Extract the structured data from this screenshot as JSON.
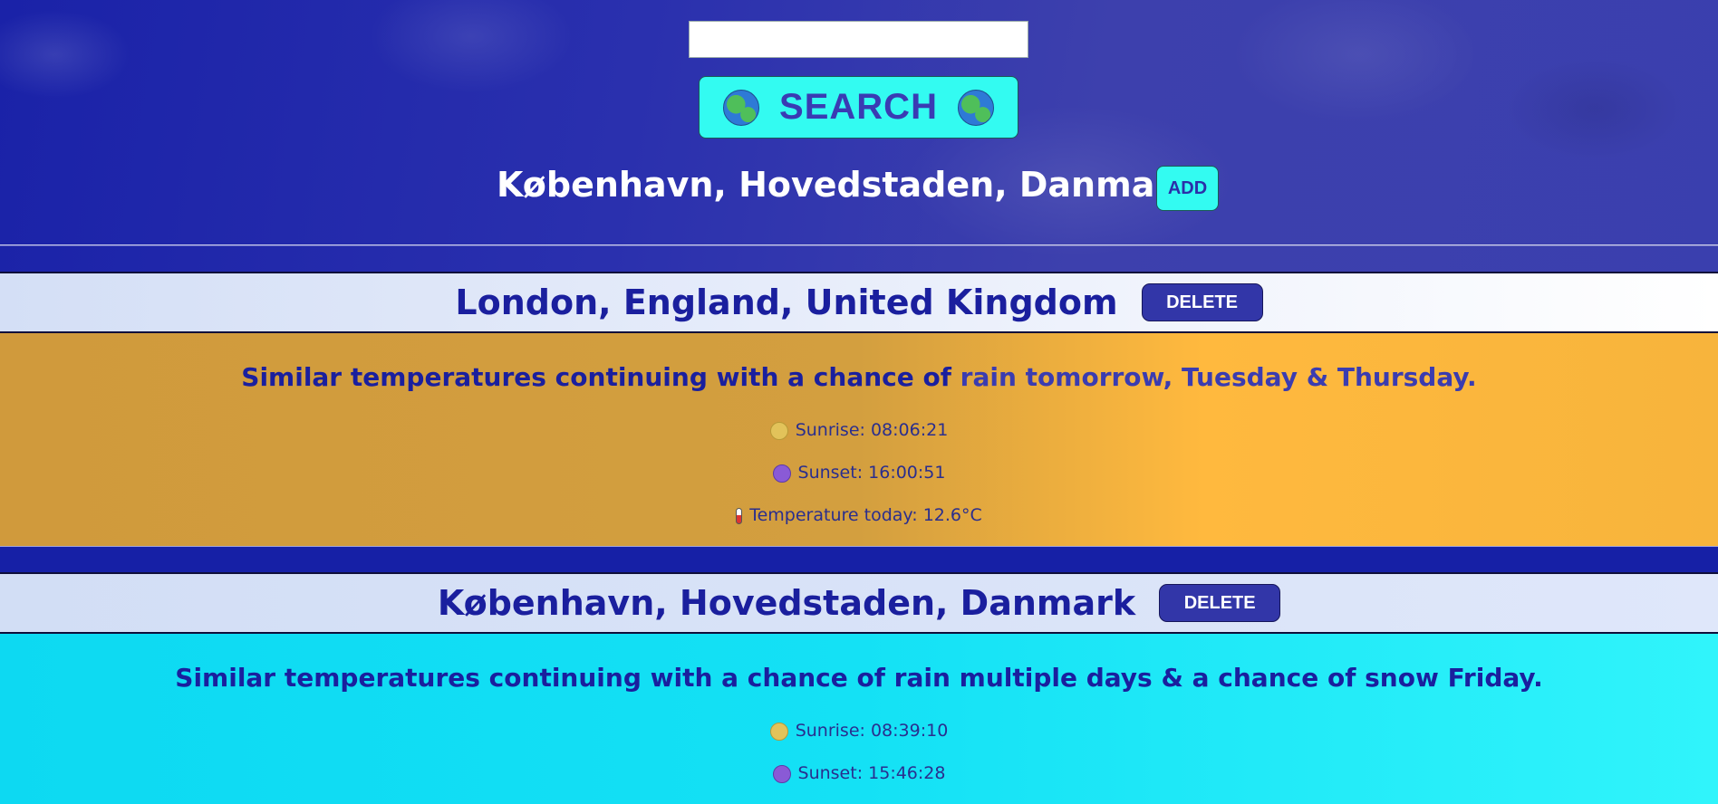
{
  "search": {
    "input_value": "",
    "button_label": "SEARCH"
  },
  "header": {
    "location": "København, Hovedstaden, Danmark",
    "add_label": "ADD"
  },
  "cards": [
    {
      "city": "London, England, United Kingdom",
      "delete_label": "DELETE",
      "forecast_prefix": "Similar temperatures continuing with a chance of ",
      "forecast_highlight": "rain tomorrow, Tuesday & Thursday.",
      "sunrise": "Sunrise: 08:06:21",
      "sunset": "Sunset: 16:00:51",
      "temperature": "Temperature today: 12.6°C",
      "theme_color": "#d39f3f"
    },
    {
      "city": "København, Hovedstaden, Danmark",
      "delete_label": "DELETE",
      "forecast": "Similar temperatures continuing with a chance of rain multiple days & a chance of snow Friday.",
      "sunrise": "Sunrise: 08:39:10",
      "sunset": "Sunset: 15:46:28",
      "theme_color": "#14e1f5"
    }
  ],
  "icons": {
    "search_button": "globe-icon",
    "sunrise": "sun-face-icon",
    "sunset": "moon-face-icon",
    "temperature": "thermometer-icon"
  },
  "colors": {
    "accent_cyan": "#33fbf1",
    "background_blue": "#1a22a8",
    "title_blue": "#1a1f9e",
    "delete_button": "#3236a8"
  }
}
